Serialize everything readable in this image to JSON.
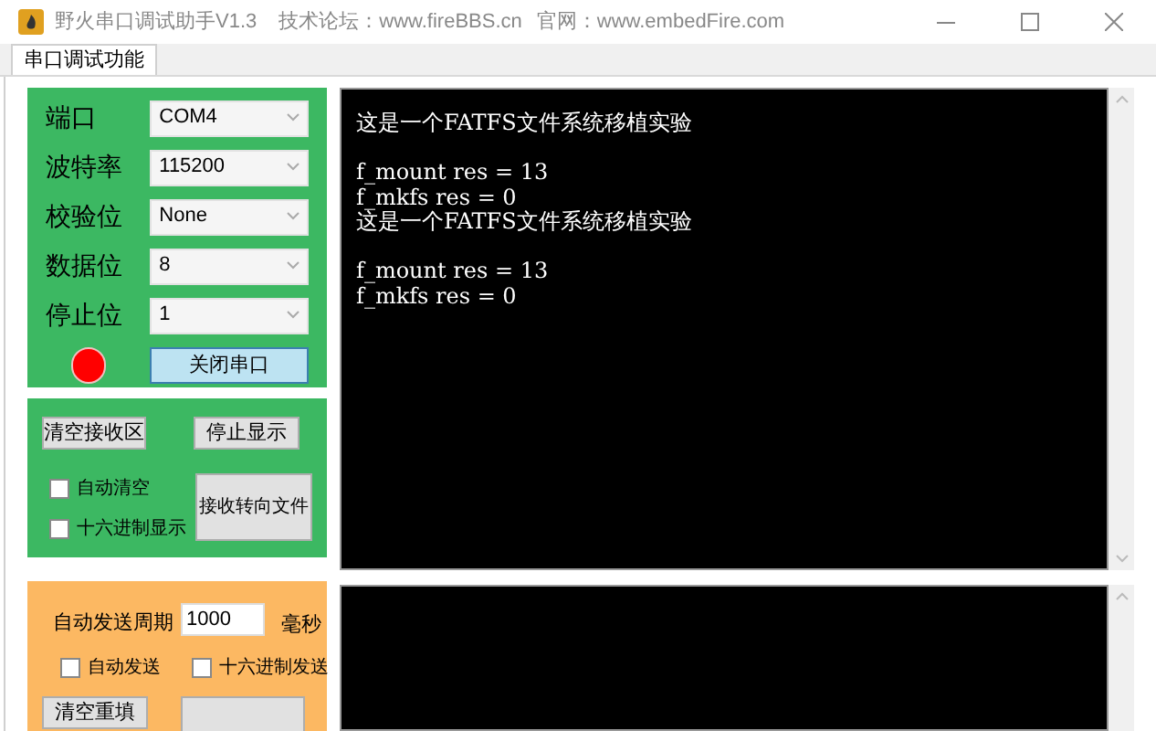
{
  "window": {
    "title": "野火串口调试助手V1.3",
    "forum": "技术论坛：www.fireBBS.cn",
    "site": "官网：www.embedFire.com"
  },
  "tabs": [
    {
      "label": "串口调试功能",
      "selected": true
    }
  ],
  "port_settings": [
    {
      "label": "端口",
      "value": "COM4"
    },
    {
      "label": "波特率",
      "value": "115200"
    },
    {
      "label": "校验位",
      "value": "None"
    },
    {
      "label": "数据位",
      "value": "8"
    },
    {
      "label": "停止位",
      "value": "1"
    }
  ],
  "port_status": {
    "open": true,
    "button": "关闭串口"
  },
  "receive_controls": {
    "clear_button": "清空接收区",
    "stop_button": "停止显示",
    "file_button": "接收转向文件",
    "checkboxes": [
      {
        "label": "自动清空",
        "checked": false
      },
      {
        "label": "十六进制显示",
        "checked": false
      }
    ]
  },
  "receive_lines": [
    {
      "text": "这是一个FATFS文件系统移植实验",
      "gap_after": true
    },
    {
      "text": "f_mount res = 13",
      "gap_after": false
    },
    {
      "text": "f_mkfs res = 0",
      "gap_after": false
    },
    {
      "text": "这是一个FATFS文件系统移植实验",
      "gap_after": true
    },
    {
      "text": "f_mount res = 13",
      "gap_after": false
    },
    {
      "text": "f_mkfs res = 0",
      "gap_after": false
    }
  ],
  "send_controls": {
    "period_label": "自动发送周期",
    "period_value": "1000",
    "unit": "毫秒",
    "checkboxes": [
      {
        "label": "自动发送",
        "checked": false
      },
      {
        "label": "十六进制发送",
        "checked": false
      }
    ],
    "clear_button": "清空重填"
  }
}
